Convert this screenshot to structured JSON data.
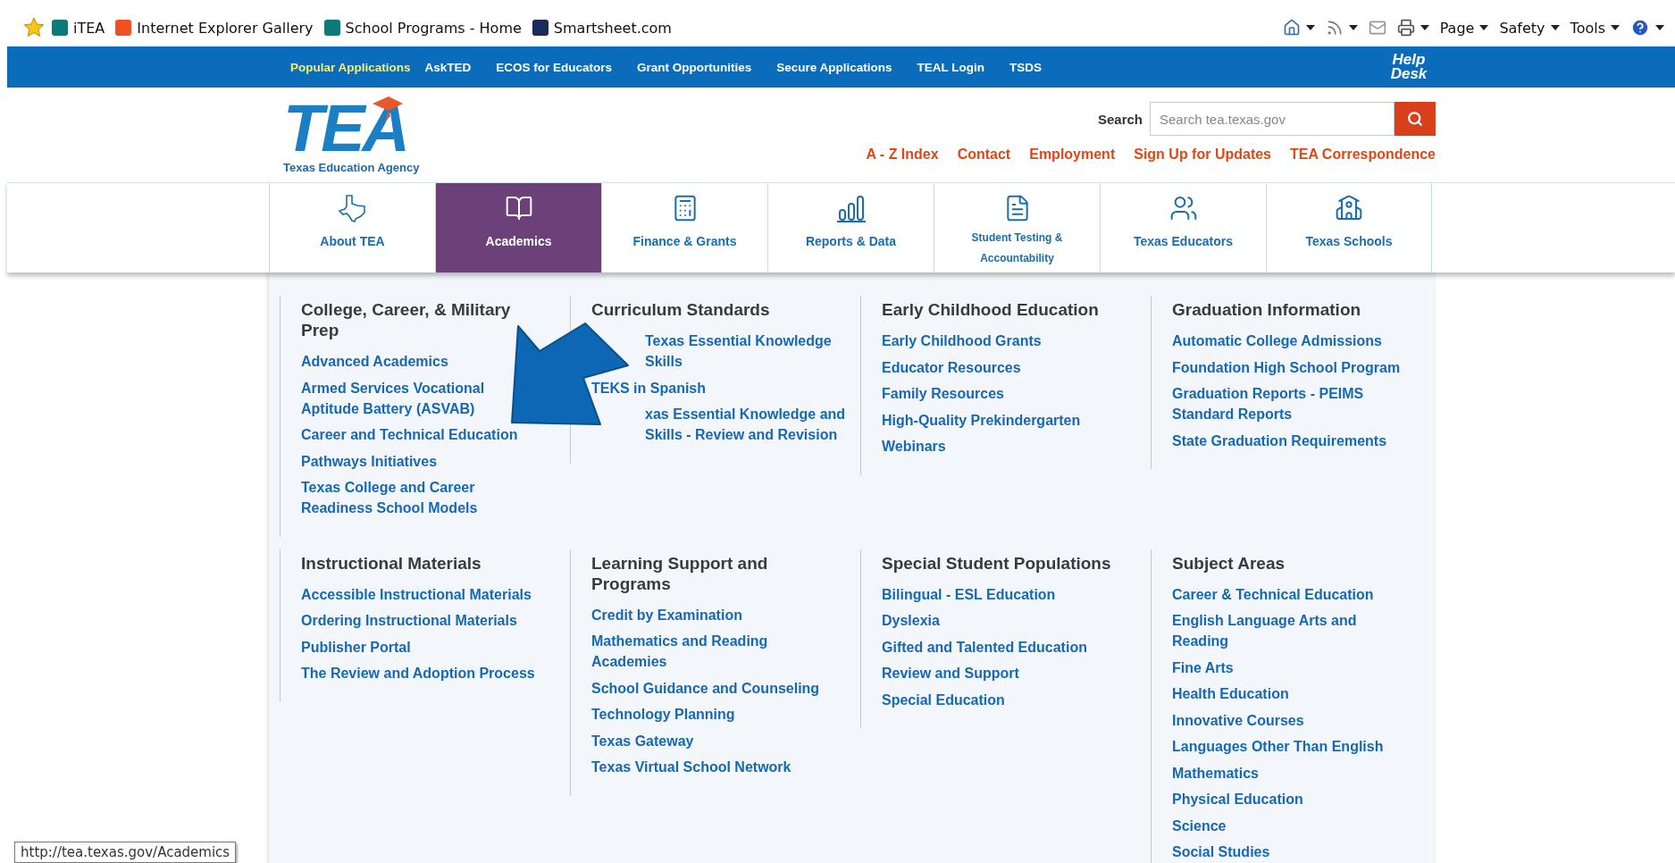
{
  "browser": {
    "favorites": [
      "iTEA",
      "Internet Explorer Gallery",
      "School Programs - Home",
      "Smartsheet.com"
    ],
    "menus": [
      "Page",
      "Safety",
      "Tools"
    ]
  },
  "top_bar": {
    "links": [
      {
        "label": "Popular Applications",
        "kind": "heading"
      },
      {
        "label": "AskTED",
        "kind": "link"
      },
      {
        "label": "ECOS for Educators",
        "kind": "link"
      },
      {
        "label": "Grant Opportunities",
        "kind": "link"
      },
      {
        "label": "Secure Applications",
        "kind": "link"
      },
      {
        "label": "TEAL Login",
        "kind": "link"
      },
      {
        "label": "TSDS",
        "kind": "link"
      }
    ],
    "help_desk": "Help Desk"
  },
  "header": {
    "logo": {
      "mark": "TEA",
      "name": "Texas Education Agency"
    },
    "search": {
      "label": "Search",
      "placeholder": "Search tea.texas.gov"
    },
    "links": [
      "A - Z Index",
      "Contact",
      "Employment",
      "Sign Up for Updates",
      "TEA Correspondence"
    ]
  },
  "nav": {
    "tabs": [
      {
        "label": "About TEA",
        "selected": false
      },
      {
        "label": "Academics",
        "selected": true
      },
      {
        "label": "Finance & Grants",
        "selected": false
      },
      {
        "label": "Reports & Data",
        "selected": false
      },
      {
        "label": "Student Testing & Accountability",
        "selected": false
      },
      {
        "label": "Texas Educators",
        "selected": false
      },
      {
        "label": "Texas Schools",
        "selected": false
      }
    ]
  },
  "menu": {
    "sections": [
      {
        "title": [
          "College, Career, & Military",
          "Prep"
        ],
        "links": [
          {
            "lines": [
              "Advanced Academics"
            ]
          },
          {
            "lines": [
              "Armed Services Vocational",
              "Aptitude Battery (ASVAB)"
            ]
          },
          {
            "lines": [
              "Career and Technical Education"
            ]
          },
          {
            "lines": [
              "Pathways Initiatives"
            ]
          },
          {
            "lines": [
              "Texas College and Career",
              "Readiness School Models"
            ]
          }
        ]
      },
      {
        "title": [
          "Curriculum Standards"
        ],
        "links": [
          {
            "lines": [
              "Texas Essential Knowledge",
              "Skills"
            ],
            "covered": true
          },
          {
            "lines": [
              "TEKS in Spanish"
            ]
          },
          {
            "lines": [
              "xas Essential Knowledge and",
              "Skills - Review and Revision"
            ],
            "covered": true
          }
        ]
      },
      {
        "title": [
          "Early Childhood Education"
        ],
        "links": [
          {
            "lines": [
              "Early Childhood Grants"
            ]
          },
          {
            "lines": [
              "Educator Resources"
            ]
          },
          {
            "lines": [
              "Family Resources"
            ]
          },
          {
            "lines": [
              "High-Quality Prekindergarten"
            ]
          },
          {
            "lines": [
              "Webinars"
            ]
          }
        ]
      },
      {
        "title": [
          "Graduation Information"
        ],
        "links": [
          {
            "lines": [
              "Automatic College Admissions"
            ]
          },
          {
            "lines": [
              "Foundation High School Program"
            ]
          },
          {
            "lines": [
              "Graduation Reports - PEIMS",
              "Standard Reports"
            ]
          },
          {
            "lines": [
              "State Graduation Requirements"
            ]
          }
        ]
      },
      {
        "title": [
          "Instructional Materials"
        ],
        "links": [
          {
            "lines": [
              "Accessible Instructional Materials"
            ]
          },
          {
            "lines": [
              "Ordering Instructional Materials"
            ]
          },
          {
            "lines": [
              "Publisher Portal"
            ]
          },
          {
            "lines": [
              "The Review and Adoption Process"
            ]
          }
        ]
      },
      {
        "title": [
          "Learning Support and",
          "Programs"
        ],
        "links": [
          {
            "lines": [
              "Credit by Examination"
            ]
          },
          {
            "lines": [
              "Mathematics and Reading",
              "Academies"
            ]
          },
          {
            "lines": [
              "School Guidance and Counseling"
            ]
          },
          {
            "lines": [
              "Technology Planning"
            ]
          },
          {
            "lines": [
              "Texas Gateway"
            ]
          },
          {
            "lines": [
              "Texas Virtual School Network"
            ]
          }
        ]
      },
      {
        "title": [
          "Special Student Populations"
        ],
        "links": [
          {
            "lines": [
              "Bilingual - ESL Education"
            ]
          },
          {
            "lines": [
              "Dyslexia"
            ]
          },
          {
            "lines": [
              "Gifted and Talented Education"
            ]
          },
          {
            "lines": [
              "Review and Support"
            ]
          },
          {
            "lines": [
              "Special Education"
            ]
          }
        ]
      },
      {
        "title": [
          "Subject Areas"
        ],
        "links": [
          {
            "lines": [
              "Career & Technical Education"
            ]
          },
          {
            "lines": [
              "English Language Arts and",
              "Reading"
            ]
          },
          {
            "lines": [
              "Fine Arts"
            ]
          },
          {
            "lines": [
              "Health Education"
            ]
          },
          {
            "lines": [
              "Innovative Courses"
            ]
          },
          {
            "lines": [
              "Languages Other Than English"
            ]
          },
          {
            "lines": [
              "Mathematics"
            ]
          },
          {
            "lines": [
              "Physical Education"
            ]
          },
          {
            "lines": [
              "Science"
            ]
          },
          {
            "lines": [
              "Social Studies"
            ]
          }
        ]
      }
    ]
  },
  "status_tooltip": "http://tea.texas.gov/Academics"
}
